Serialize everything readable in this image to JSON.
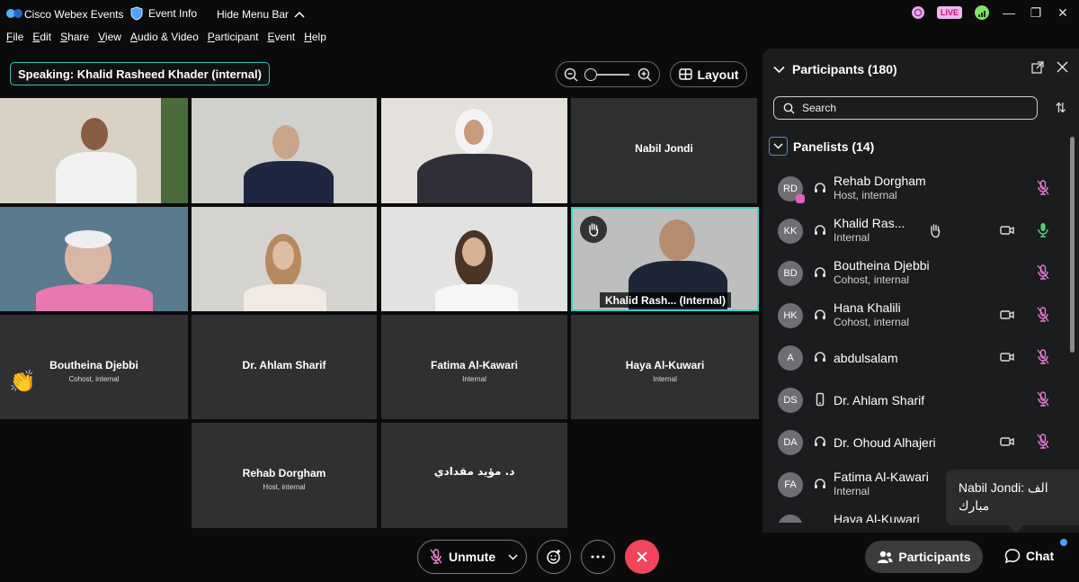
{
  "titlebar": {
    "app_name": "Cisco Webex Events",
    "event_info": "Event Info",
    "hide_menu": "Hide Menu Bar",
    "live": "LIVE"
  },
  "menu": [
    "File",
    "Edit",
    "Share",
    "View",
    "Audio & Video",
    "Participant",
    "Event",
    "Help"
  ],
  "speaking": {
    "label": "Speaking:",
    "name": "Khalid Rasheed Khader (internal)"
  },
  "layout_label": "Layout",
  "tiles": {
    "nabil": "Nabil Jondi",
    "khalid_strip": "Khalid Rash... (Internal)",
    "boutheina_name": "Boutheina Djebbi",
    "boutheina_role": "Cohost, internal",
    "ahlam_name": "Dr. Ahlam Sharif",
    "fatima_name": "Fatima Al-Kawari",
    "fatima_role": "Internal",
    "haya_name": "Haya Al-Kuwari",
    "haya_role": "Internal",
    "rehab_name": "Rehab Dorgham",
    "rehab_role": "Host, internal",
    "moayad_name": "د. مؤيد مقدادي"
  },
  "panel": {
    "title": "Participants (180)",
    "search_placeholder": "Search",
    "panelists_label": "Panelists (14)",
    "participants": [
      {
        "initials": "RD",
        "name": "Rehab Dorgham",
        "role": "Host, internal"
      },
      {
        "initials": "KK",
        "name": "Khalid Ras...",
        "role": "Internal"
      },
      {
        "initials": "BD",
        "name": "Boutheina Djebbi",
        "role": "Cohost, internal"
      },
      {
        "initials": "HK",
        "name": "Hana Khalili",
        "role": "Cohost, internal"
      },
      {
        "initials": "A",
        "name": "abdulsalam",
        "role": ""
      },
      {
        "initials": "DS",
        "name": "Dr. Ahlam Sharif",
        "role": ""
      },
      {
        "initials": "DA",
        "name": "Dr. Ohoud Alhajeri",
        "role": ""
      },
      {
        "initials": "FA",
        "name": "Fatima Al-Kawari",
        "role": "Internal"
      },
      {
        "initials": "HA",
        "name": "Haya Al-Kuwari",
        "role": ""
      }
    ]
  },
  "toast": {
    "line1": "Nabil Jondi:  الف",
    "line2": "مبارك"
  },
  "bottom": {
    "unmute": "Unmute",
    "participants": "Participants",
    "chat": "Chat"
  },
  "colors": {
    "accent_teal": "#35c4bd",
    "leave_red": "#f0455b",
    "mic_muted": "#e878d8",
    "mic_active": "#4fd27a"
  }
}
